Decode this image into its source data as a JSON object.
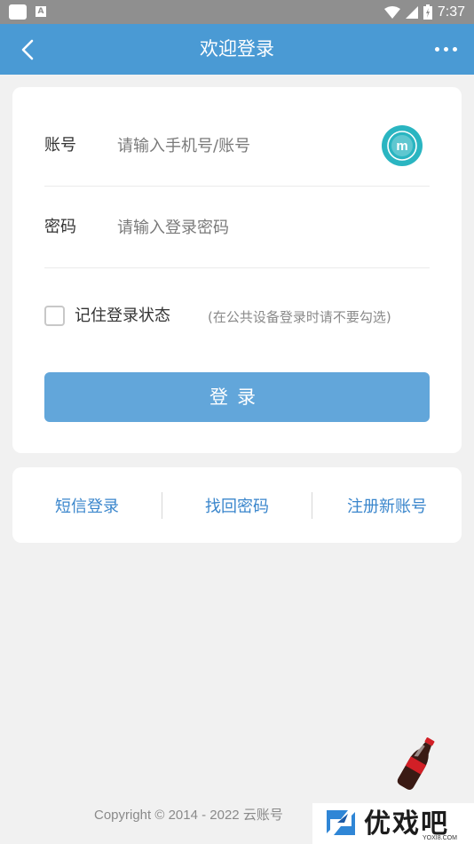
{
  "status_bar": {
    "time": "7:37",
    "notification_icon_letter": "A"
  },
  "header": {
    "title": "欢迎登录",
    "color": "#4a9ad4"
  },
  "form": {
    "account_label": "账号",
    "account_placeholder": "请输入手机号/账号",
    "password_label": "密码",
    "password_placeholder": "请输入登录密码",
    "brand_logo_letter": "m",
    "remember_label": "记住登录状态",
    "remember_checked": false,
    "remember_note": "(在公共设备登录时请不要勾选)",
    "login_button": "登录"
  },
  "links": {
    "sms_login": "短信登录",
    "find_password": "找回密码",
    "register": "注册新账号"
  },
  "footer": {
    "copyright": "Copyright © 2014 - 2022 云账号"
  },
  "watermark": {
    "title": "优戏吧",
    "subtitle": "YOXI8.COM"
  },
  "colors": {
    "accent": "#4a9ad4",
    "button": "#62a6da",
    "link": "#3a86cc"
  }
}
